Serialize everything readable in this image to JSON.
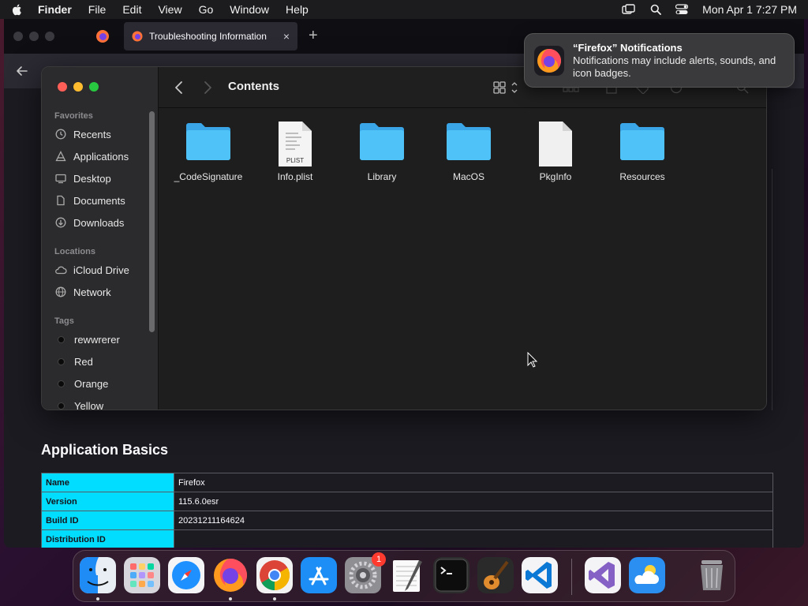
{
  "menubar": {
    "app": "Finder",
    "items": [
      "File",
      "Edit",
      "View",
      "Go",
      "Window",
      "Help"
    ],
    "datetime": "Mon Apr 1  7:27 PM"
  },
  "firefox": {
    "tab_title": "Troubleshooting Information",
    "tab_close": "×",
    "new_tab": "+",
    "section_title": "Application Basics",
    "basics": [
      {
        "key": "Name",
        "value": "Firefox"
      },
      {
        "key": "Version",
        "value": "115.6.0esr"
      },
      {
        "key": "Build ID",
        "value": "20231211164624"
      },
      {
        "key": "Distribution ID",
        "value": ""
      }
    ]
  },
  "finder": {
    "title": "Contents",
    "sidebar": {
      "favorites_header": "Favorites",
      "favorites": [
        {
          "label": "Recents",
          "icon": "clock-icon"
        },
        {
          "label": "Applications",
          "icon": "applications-icon"
        },
        {
          "label": "Desktop",
          "icon": "desktop-icon"
        },
        {
          "label": "Documents",
          "icon": "document-icon"
        },
        {
          "label": "Downloads",
          "icon": "download-icon"
        }
      ],
      "locations_header": "Locations",
      "locations": [
        {
          "label": "iCloud Drive",
          "icon": "cloud-icon"
        },
        {
          "label": "Network",
          "icon": "globe-icon"
        }
      ],
      "tags_header": "Tags",
      "tags": [
        "rewwrerer",
        "Red",
        "Orange",
        "Yellow"
      ]
    },
    "files": [
      {
        "name": "_CodeSignature",
        "type": "folder"
      },
      {
        "name": "Info.plist",
        "type": "plist",
        "badge": "PLIST"
      },
      {
        "name": "Library",
        "type": "folder"
      },
      {
        "name": "MacOS",
        "type": "folder"
      },
      {
        "name": "PkgInfo",
        "type": "file"
      },
      {
        "name": "Resources",
        "type": "folder"
      }
    ]
  },
  "notification": {
    "title": "“Firefox” Notifications",
    "body": "Notifications may include alerts, sounds, and icon badges."
  },
  "dock": {
    "apps": [
      "Finder",
      "Launchpad",
      "Safari",
      "Firefox",
      "Chrome",
      "App Store",
      "System Settings",
      "TextEdit",
      "Terminal",
      "GarageBand",
      "Visual Studio Code",
      "Visual Studio",
      "Weather",
      "Trash"
    ],
    "settings_badge": "1"
  },
  "colors": {
    "table_key_bg": "#00ddff",
    "folder_blue": "#4fc3f7",
    "accent_red": "#ff3b30"
  }
}
